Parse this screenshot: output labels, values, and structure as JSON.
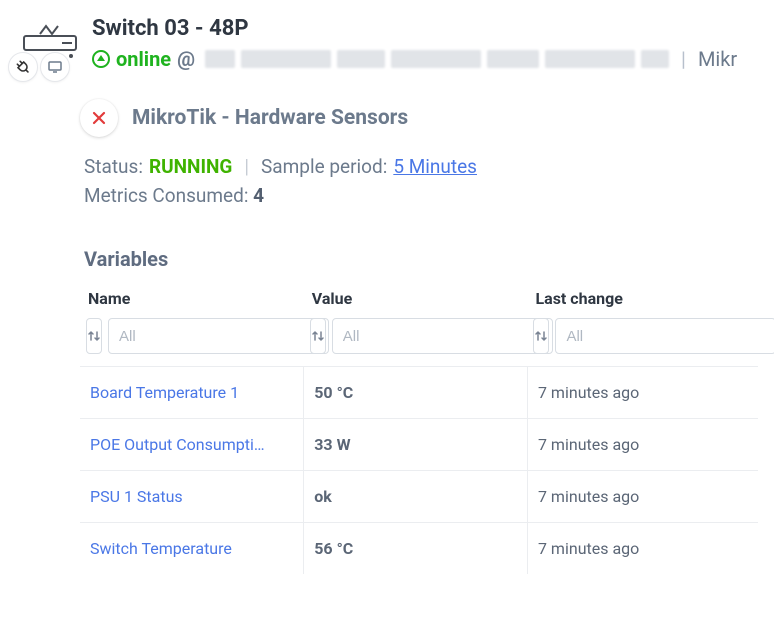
{
  "header": {
    "title": "Switch 03 - 48P",
    "online_label": "online",
    "at": "@",
    "vendor_truncated": "Mikr"
  },
  "panel": {
    "title": "MikroTik - Hardware Sensors",
    "status_label": "Status:",
    "status_value": "RUNNING",
    "sample_label": "Sample period:",
    "sample_value": "5 Minutes",
    "metrics_label": "Metrics Consumed:",
    "metrics_value": "4",
    "variables_heading": "Variables"
  },
  "table": {
    "columns": {
      "name": "Name",
      "value": "Value",
      "last_change": "Last change"
    },
    "filter_placeholder": "All",
    "rows": [
      {
        "name": "Board Temperature 1",
        "value": "50 °C",
        "last_change": "7 minutes ago"
      },
      {
        "name": "POE Output Consumpti…",
        "value": "33 W",
        "last_change": "7 minutes ago"
      },
      {
        "name": "PSU 1 Status",
        "value": "ok",
        "last_change": "7 minutes ago"
      },
      {
        "name": "Switch Temperature",
        "value": "56 °C",
        "last_change": "7 minutes ago"
      }
    ]
  }
}
